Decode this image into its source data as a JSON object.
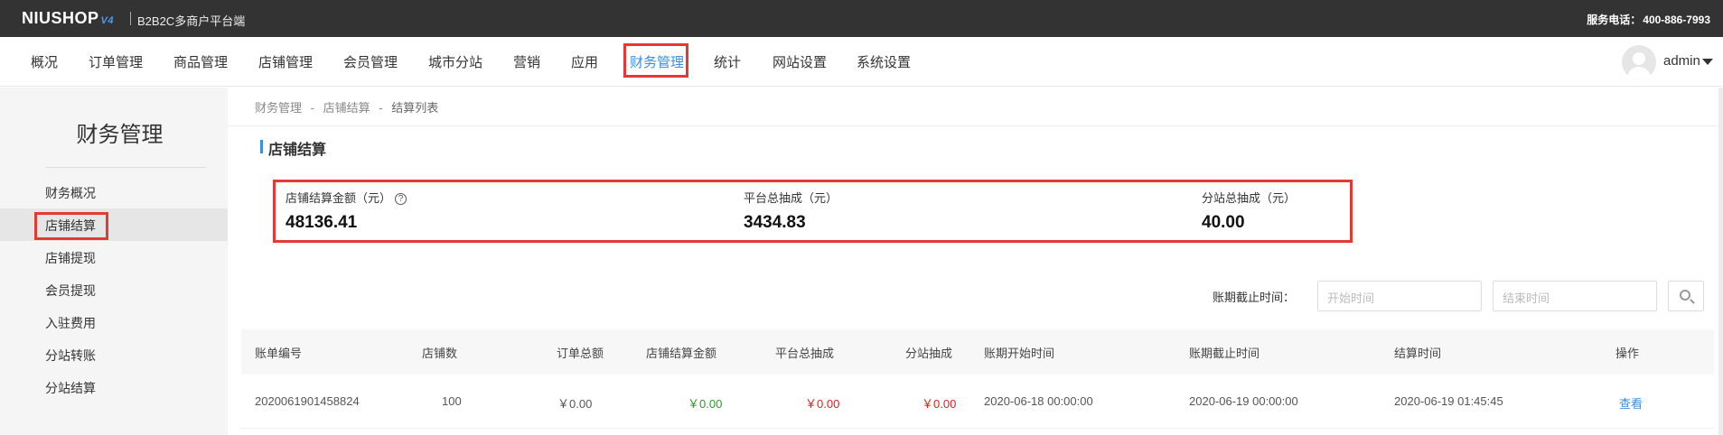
{
  "topbar": {
    "logo_text": "NIUSHOP",
    "logo_version": "V4",
    "subtitle": "B2B2C多商户平台端",
    "hotline_label": "服务电话：",
    "hotline_number": "400-886-7993"
  },
  "nav": {
    "items": [
      "概况",
      "订单管理",
      "商品管理",
      "店铺管理",
      "会员管理",
      "城市分站",
      "营销",
      "应用",
      "财务管理",
      "统计",
      "网站设置",
      "系统设置"
    ],
    "active": "财务管理",
    "user": "admin"
  },
  "sidebar": {
    "title": "财务管理",
    "items": [
      "财务概况",
      "店铺结算",
      "店铺提现",
      "会员提现",
      "入驻费用",
      "分站转账",
      "分站结算"
    ],
    "active": "店铺结算"
  },
  "breadcrumb": {
    "items": [
      "财务管理",
      "店铺结算",
      "结算列表"
    ],
    "separator": "-"
  },
  "section_title": "店铺结算",
  "stats": [
    {
      "label": "店铺结算金额（元）",
      "value": "48136.41"
    },
    {
      "label": "平台总抽成（元）",
      "value": "3434.83"
    },
    {
      "label": "分站总抽成（元）",
      "value": "40.00"
    }
  ],
  "filter": {
    "label": "账期截止时间：",
    "start_placeholder": "开始时间",
    "end_placeholder": "结束时间"
  },
  "table": {
    "columns": [
      "账单编号",
      "店铺数",
      "订单总额",
      "店铺结算金额",
      "平台总抽成",
      "分站抽成",
      "账期开始时间",
      "账期截止时间",
      "结算时间",
      "操作"
    ],
    "rows": [
      {
        "bill_no": "2020061901458824",
        "shop_count": "100",
        "order_total": "￥0.00",
        "shop_settle": "￥0.00",
        "platform_commission": "￥0.00",
        "substation_commission": "￥0.00",
        "period_start": "2020-06-18 00:00:00",
        "period_end": "2020-06-19 00:00:00",
        "settle_time": "2020-06-19 01:45:45",
        "action": "查看"
      }
    ]
  },
  "colors": {
    "accent": "#3a8ee6",
    "topbar": "#333333",
    "highlight": "#e53935",
    "positive": "#2e9a2e",
    "negative": "#e02020"
  }
}
